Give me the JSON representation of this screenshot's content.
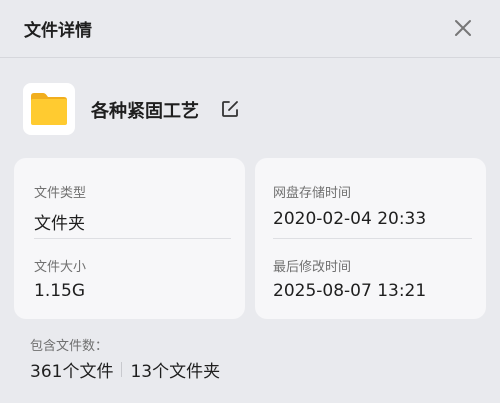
{
  "header": {
    "title": "文件详情",
    "close_icon": "close-icon"
  },
  "file": {
    "icon": "folder-icon",
    "name": "各种紧固工艺",
    "edit_icon": "edit-icon",
    "folder_color": "#ffc928"
  },
  "info": {
    "type_label": "文件类型",
    "type_value": "文件夹",
    "size_label": "文件大小",
    "size_value": "1.15G",
    "stored_label": "网盘存储时间",
    "stored_value": "2020-02-04 20:33",
    "modified_label": "最后修改时间",
    "modified_value": "2025-08-07 13:21"
  },
  "contents": {
    "label": "包含文件数：",
    "files": "361个文件",
    "folders": "13个文件夹"
  }
}
